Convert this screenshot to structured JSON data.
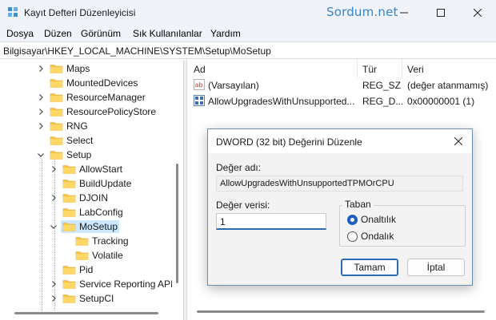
{
  "window": {
    "title": "Kayıt Defteri Düzenleyicisi",
    "watermark": "Sordum.net"
  },
  "menu": [
    "Dosya",
    "Düzen",
    "Görünüm",
    "Sık Kullanılanlar",
    "Yardım"
  ],
  "address": "Bilgisayar\\HKEY_LOCAL_MACHINE\\SYSTEM\\Setup\\MoSetup",
  "tree": [
    {
      "label": "Maps",
      "expandable": true,
      "expanded": false
    },
    {
      "label": "MountedDevices",
      "expandable": false
    },
    {
      "label": "ResourceManager",
      "expandable": true,
      "expanded": false
    },
    {
      "label": "ResourcePolicyStore",
      "expandable": true,
      "expanded": false
    },
    {
      "label": "RNG",
      "expandable": true,
      "expanded": false
    },
    {
      "label": "Select",
      "expandable": false
    },
    {
      "label": "Setup",
      "expandable": true,
      "expanded": true
    },
    {
      "label": "AllowStart",
      "expandable": true,
      "expanded": false
    },
    {
      "label": "BuildUpdate",
      "expandable": false
    },
    {
      "label": "DJOIN",
      "expandable": true,
      "expanded": false
    },
    {
      "label": "LabConfig",
      "expandable": false
    },
    {
      "label": "MoSetup",
      "expandable": true,
      "expanded": true,
      "selected": true
    },
    {
      "label": "Tracking",
      "expandable": false
    },
    {
      "label": "Volatile",
      "expandable": false
    },
    {
      "label": "Pid",
      "expandable": false
    },
    {
      "label": "Service Reporting API",
      "expandable": true,
      "expanded": false
    },
    {
      "label": "SetupCI",
      "expandable": true,
      "expanded": false
    }
  ],
  "list": {
    "headers": {
      "name": "Ad",
      "type": "Tür",
      "data": "Veri"
    },
    "rows": [
      {
        "icon": "string-value-icon",
        "name": "(Varsayılan)",
        "type": "REG_SZ",
        "data": "(değer atanmamış)"
      },
      {
        "icon": "dword-value-icon",
        "name": "AllowUpgradesWithUnsupported...",
        "type": "REG_D...",
        "data": "0x00000001 (1)"
      }
    ]
  },
  "dialog": {
    "title": "DWORD (32 bit) Değerini Düzenle",
    "name_label": "Değer adı:",
    "name_value": "AllowUpgradesWithUnsupportedTPMOrCPU",
    "data_label": "Değer verisi:",
    "data_value": "1",
    "base_label": "Taban",
    "base_options": [
      {
        "label": "Onaltılık",
        "checked": true
      },
      {
        "label": "Ondalık",
        "checked": false
      }
    ],
    "ok_label": "Tamam",
    "cancel_label": "İptal"
  },
  "colors": {
    "accent": "#2b6cb0",
    "selection": "#cce8ff",
    "folder": "#f6c547"
  }
}
